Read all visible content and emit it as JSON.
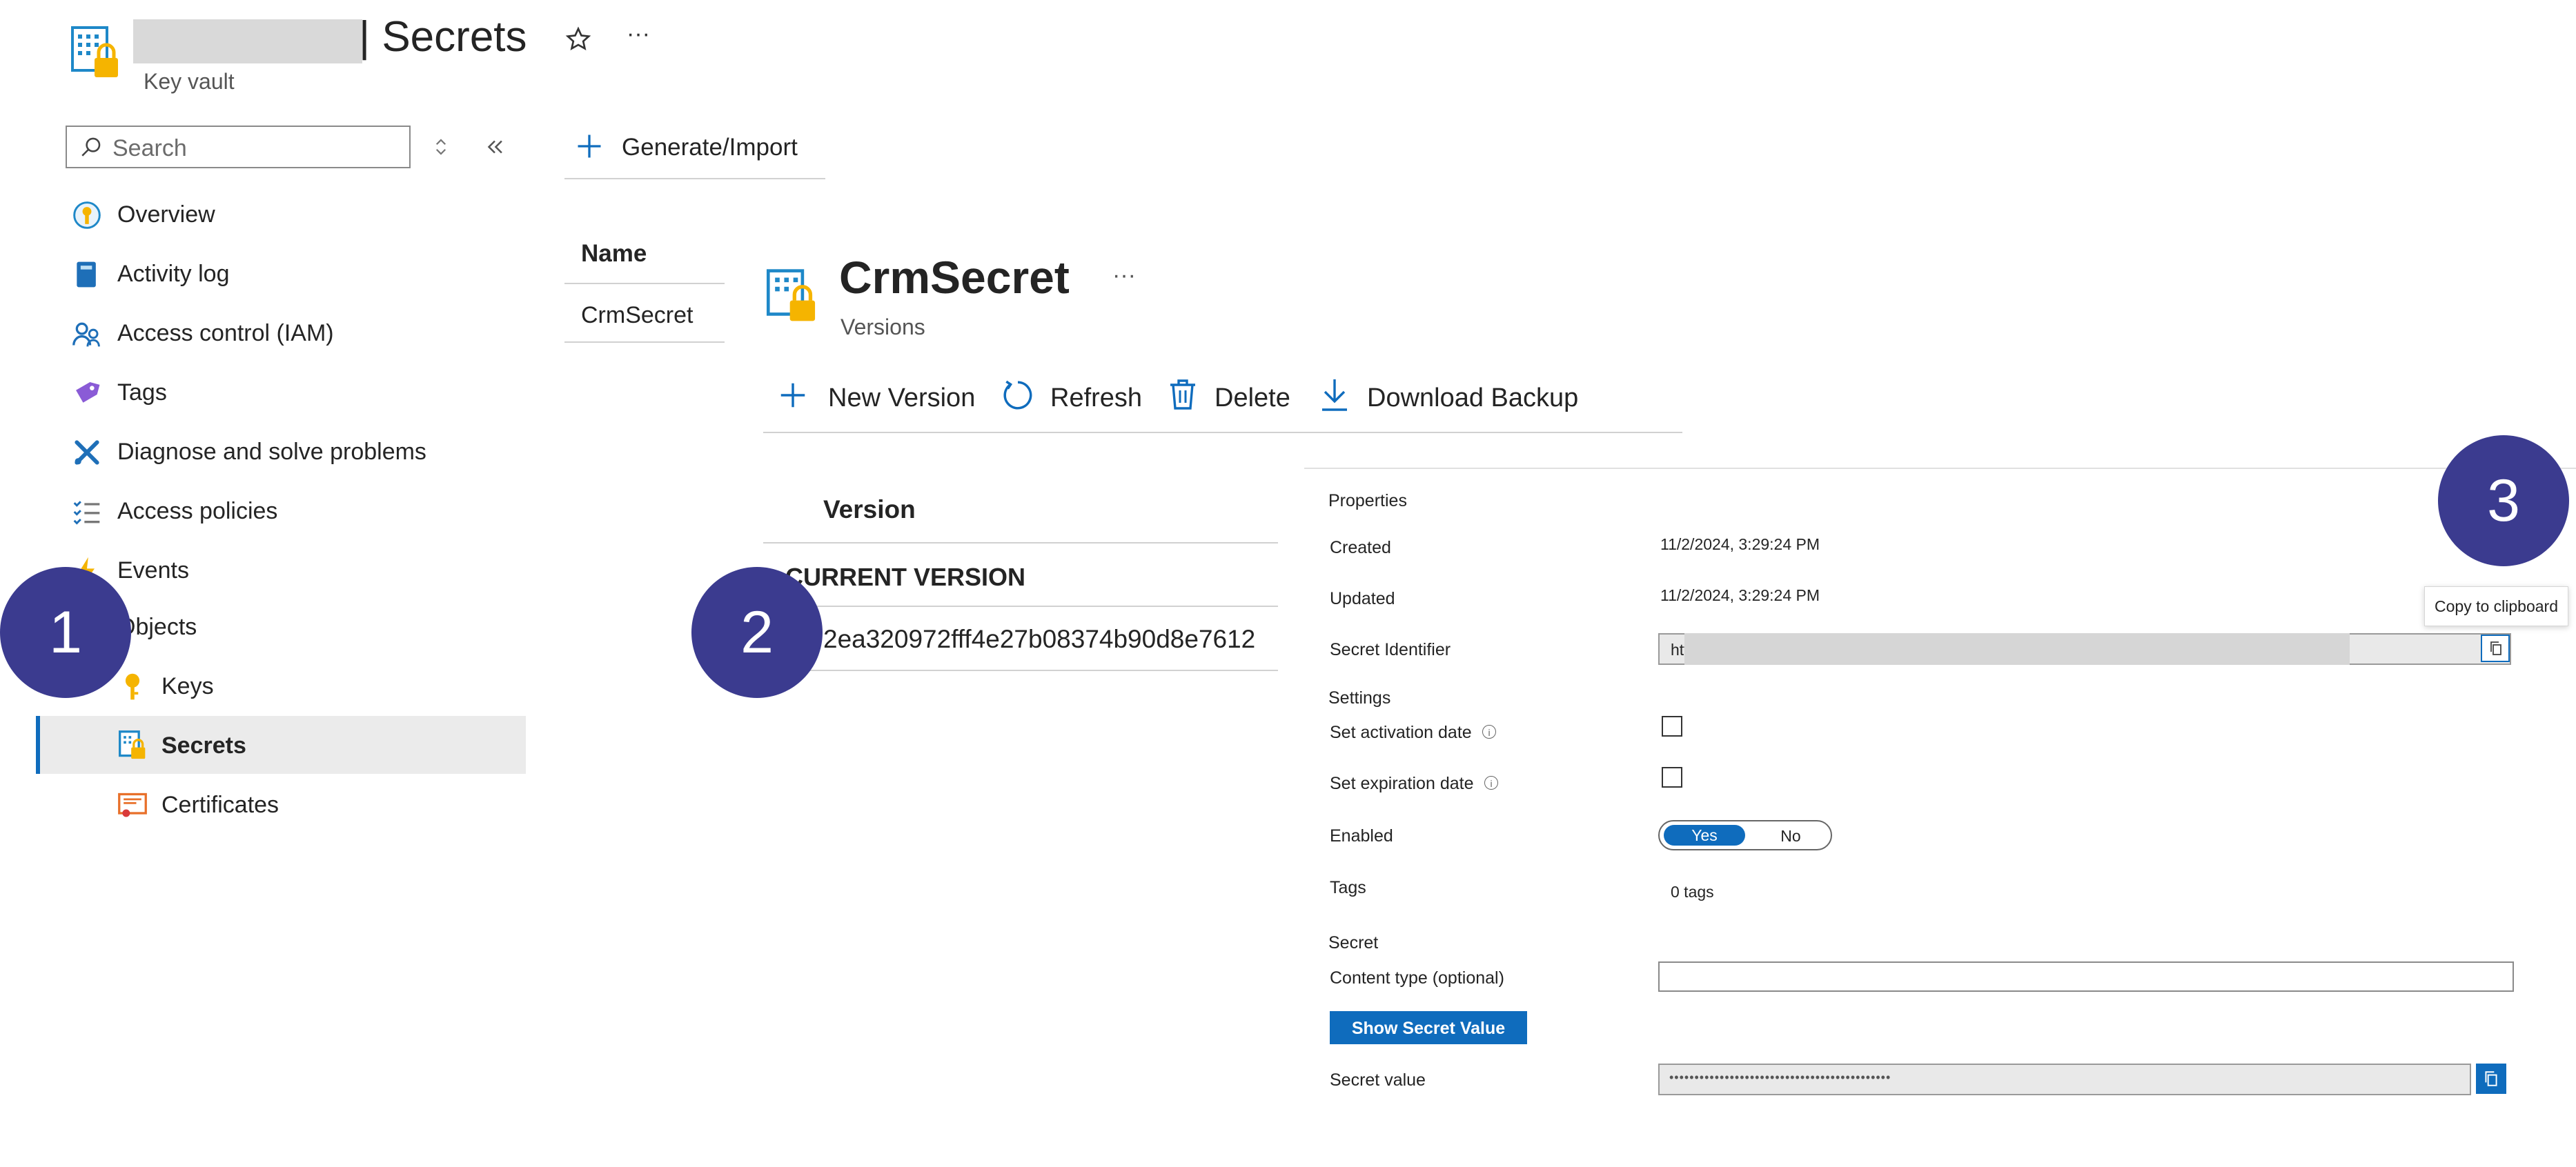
{
  "header": {
    "title": "| Secrets",
    "subtitle": "Key vault"
  },
  "sidebar": {
    "search_placeholder": "Search",
    "items": [
      {
        "label": "Overview"
      },
      {
        "label": "Activity log"
      },
      {
        "label": "Access control (IAM)"
      },
      {
        "label": "Tags"
      },
      {
        "label": "Diagnose and solve problems"
      },
      {
        "label": "Access policies"
      },
      {
        "label": "Events"
      },
      {
        "label": "Objects"
      },
      {
        "label": "Keys"
      },
      {
        "label": "Secrets"
      },
      {
        "label": "Certificates"
      }
    ]
  },
  "toolbar": {
    "generate_label": "Generate/Import"
  },
  "secrets_list": {
    "column_name": "Name",
    "rows": [
      "CrmSecret"
    ]
  },
  "secret": {
    "name": "CrmSecret",
    "subtitle": "Versions",
    "more": "···",
    "actions": {
      "new_version": "New Version",
      "refresh": "Refresh",
      "delete": "Delete",
      "download_backup": "Download Backup"
    },
    "versions": {
      "column": "Version",
      "group": "CURRENT VERSION",
      "rows": [
        "2ea320972fff4e27b08374b90d8e7612"
      ]
    }
  },
  "properties": {
    "heading": "Properties",
    "created_label": "Created",
    "created_value": "11/2/2024, 3:29:24 PM",
    "updated_label": "Updated",
    "updated_value": "11/2/2024, 3:29:24 PM",
    "identifier_label": "Secret Identifier",
    "identifier_value": "https://",
    "settings_heading": "Settings",
    "activation_label": "Set activation date",
    "expiration_label": "Set expiration date",
    "enabled_label": "Enabled",
    "enabled_yes": "Yes",
    "enabled_no": "No",
    "tags_label": "Tags",
    "tags_value": "0 tags",
    "secret_heading": "Secret",
    "content_type_label": "Content type (optional)",
    "show_value_button": "Show Secret Value",
    "secret_value_label": "Secret value",
    "secret_value_masked": "••••••••••••••••••••••••••••••••••••••••••••",
    "tooltip": "Copy to clipboard"
  },
  "badges": [
    "1",
    "2",
    "3"
  ],
  "colors": {
    "accent": "#0f6cbd",
    "badge": "#3b3b8f",
    "selected_bg": "#ebebeb"
  }
}
